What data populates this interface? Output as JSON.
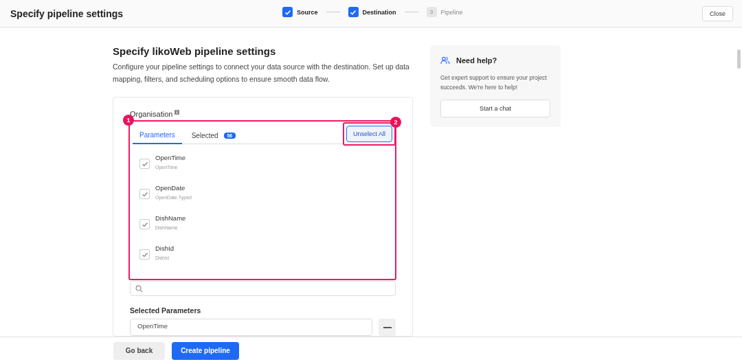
{
  "header": {
    "title": "Specify pipeline settings",
    "close": "Close"
  },
  "steps": [
    {
      "label": "Source",
      "done": true
    },
    {
      "label": "Destination",
      "done": true
    },
    {
      "label": "Pipeline",
      "number": "3",
      "done": false
    }
  ],
  "main": {
    "heading": "Specify likoWeb pipeline settings",
    "description": "Configure your pipeline settings to connect your data source with the destination. Set up data mapping, filters, and scheduling options to ensure smooth data flow."
  },
  "form": {
    "section_label": "Organisation",
    "tabs": [
      {
        "label": "Parameters",
        "selected": true
      },
      {
        "label": "Selected",
        "badge": "56",
        "selected": false
      }
    ],
    "unselect_button": "Unselect All",
    "callouts": [
      "1",
      "2"
    ],
    "parameters": [
      {
        "name": "OpenTime",
        "path": "OpenTime",
        "checked": true
      },
      {
        "name": "OpenDate",
        "path": "OpenDate.Typed",
        "checked": true
      },
      {
        "name": "DishName",
        "path": "DishName",
        "checked": true
      },
      {
        "name": "DishId",
        "path": "DishId",
        "checked": true
      }
    ],
    "selected_label": "Selected Parameters",
    "selected_values": [
      "OpenTime"
    ]
  },
  "help": {
    "title": "Need help?",
    "text": "Get expert support to ensure your project succeeds. We're here to help!",
    "button": "Start a chat"
  },
  "footer": {
    "back": "Go back",
    "create": "Create pipeline"
  }
}
